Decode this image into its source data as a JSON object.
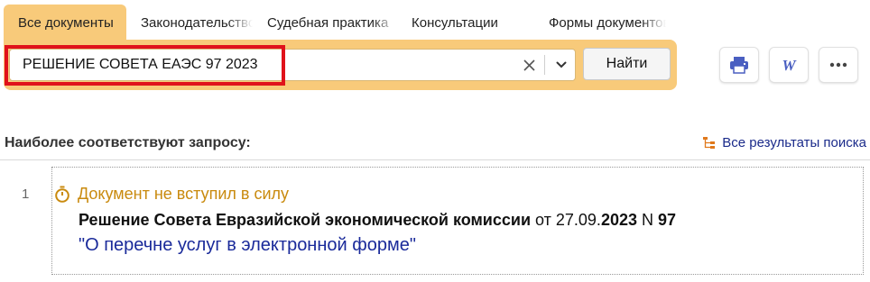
{
  "tabs": [
    {
      "label": "Все документы",
      "active": true
    },
    {
      "label": "Законодательство",
      "active": false
    },
    {
      "label": "Судебная практика",
      "active": false
    },
    {
      "label": "Консультации",
      "active": false
    },
    {
      "label": "Формы документов",
      "active": false
    }
  ],
  "search": {
    "value": "РЕШЕНИЕ СОВЕТА ЕАЭС 97 2023",
    "find_label": "Найти"
  },
  "toolbar": {
    "print_icon": "print-icon",
    "word_icon": "word-export-icon",
    "more_icon": "more-icon"
  },
  "results": {
    "heading": "Наиболее соответствуют запросу:",
    "all_results_label": "Все результаты поиска",
    "items": [
      {
        "number": "1",
        "status": "Документ не вступил в силу",
        "doc_title_bold": "Решение Совета Евразийской экономической комиссии",
        "doc_date_prefix": " от 27.09.",
        "doc_year": "2023",
        "doc_number_prefix": " N ",
        "doc_number": "97",
        "doc_name": "\"О перечне услуг в электронной форме\""
      }
    ]
  },
  "colors": {
    "accent": "#f8ca7a",
    "highlight_frame": "#e0121b",
    "status": "#c98a0e",
    "link": "#1a2a9a"
  }
}
